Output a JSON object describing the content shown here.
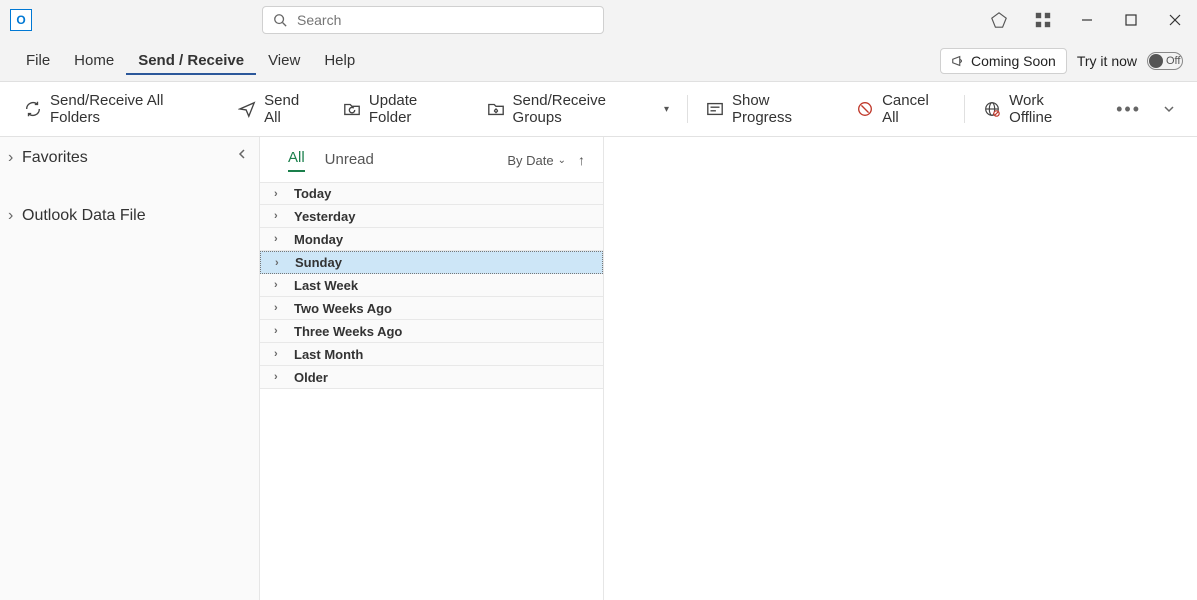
{
  "search": {
    "placeholder": "Search"
  },
  "menubar": {
    "file": "File",
    "home": "Home",
    "send_receive": "Send / Receive",
    "view": "View",
    "help": "Help",
    "coming_soon": "Coming Soon",
    "try_it_now": "Try it now",
    "toggle_state": "Off"
  },
  "ribbon": {
    "send_receive_all": "Send/Receive All Folders",
    "send_all": "Send All",
    "update_folder": "Update Folder",
    "groups": "Send/Receive Groups",
    "show_progress": "Show Progress",
    "cancel_all": "Cancel All",
    "work_offline": "Work Offline"
  },
  "nav": {
    "favorites": "Favorites",
    "data_file": "Outlook Data File"
  },
  "listpane": {
    "tab_all": "All",
    "tab_unread": "Unread",
    "sort_label": "By Date",
    "groups": [
      "Today",
      "Yesterday",
      "Monday",
      "Sunday",
      "Last Week",
      "Two Weeks Ago",
      "Three Weeks Ago",
      "Last Month",
      "Older"
    ],
    "selected_index": 3
  }
}
